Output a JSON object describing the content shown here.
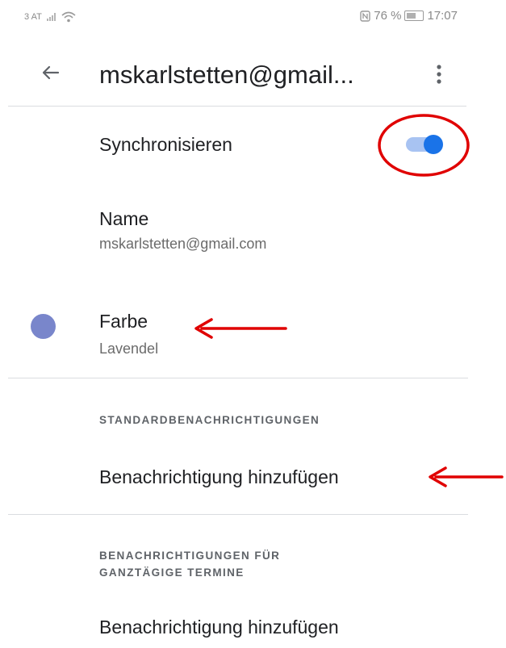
{
  "status_bar": {
    "carrier": "3 AT",
    "battery_percent": "76 %",
    "time": "17:07"
  },
  "app_bar": {
    "title": "mskarlstetten@gmail...",
    "back_icon": "arrow-left-icon",
    "menu_icon": "more-vert-icon"
  },
  "sync": {
    "label": "Synchronisieren",
    "enabled": true,
    "track_color": "#a8c3f2",
    "thumb_color": "#1a73e8"
  },
  "name": {
    "label": "Name",
    "value": "mskarlstetten@gmail.com"
  },
  "color": {
    "label": "Farbe",
    "value": "Lavendel",
    "swatch": "#7986cb"
  },
  "default_notifications": {
    "header": "STANDARDBENACHRICHTIGUNGEN",
    "add_label": "Benachrichtigung hinzufügen"
  },
  "allday_notifications": {
    "header_line1": "BENACHRICHTIGUNGEN FÜR",
    "header_line2": "GANZTÄGIGE TERMINE",
    "add_label": "Benachrichtigung hinzufügen"
  },
  "annotations": {
    "color": "#e00000"
  }
}
